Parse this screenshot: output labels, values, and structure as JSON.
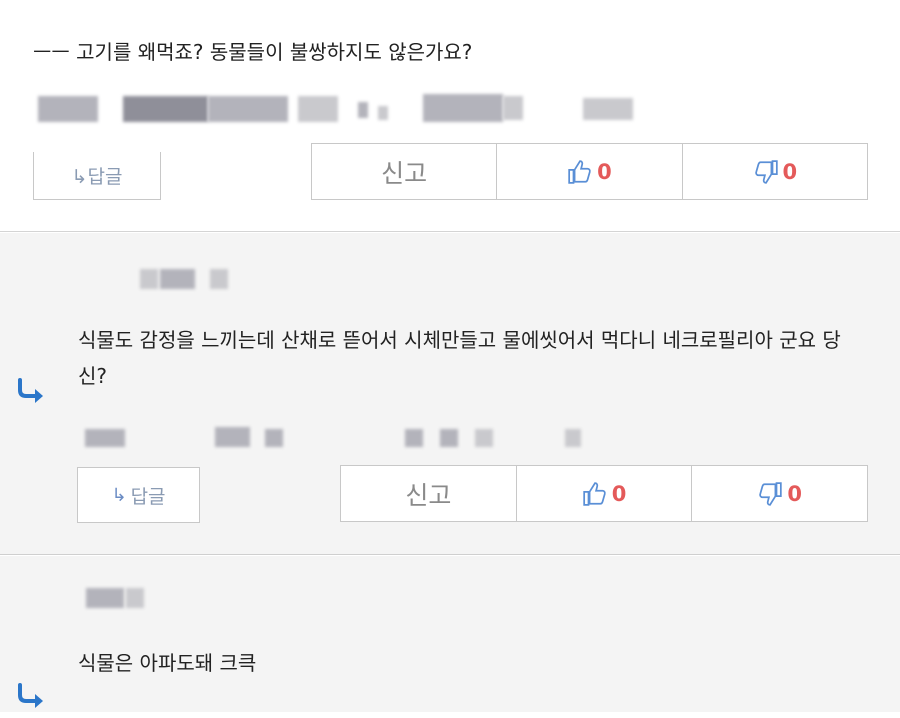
{
  "comments": [
    {
      "text": "ㅡㅡ 고기를 왜먹죠? 동물들이 불쌍하지도 않은가요?",
      "reply_label": "↳답글",
      "report_label": "신고",
      "likes": "0",
      "dislikes": "0"
    },
    {
      "text": "식물도 감정을 느끼는데 산채로 뜯어서 시체만들고 물에씻어서 먹다니 네크로필리아 군요 당신?",
      "reply_label": "답글",
      "reply_arrow": "↳",
      "report_label": "신고",
      "likes": "0",
      "dislikes": "0"
    },
    {
      "text": "식물은 아파도돼 크큭"
    }
  ],
  "icons": {
    "reply_indicator": "reply-arrow-icon",
    "like": "thumbs-up-icon",
    "dislike": "thumbs-down-icon"
  },
  "colors": {
    "count": "#e45a5a",
    "icon_blue": "#2b76c9",
    "thumb_blue": "#5a8fd6"
  }
}
